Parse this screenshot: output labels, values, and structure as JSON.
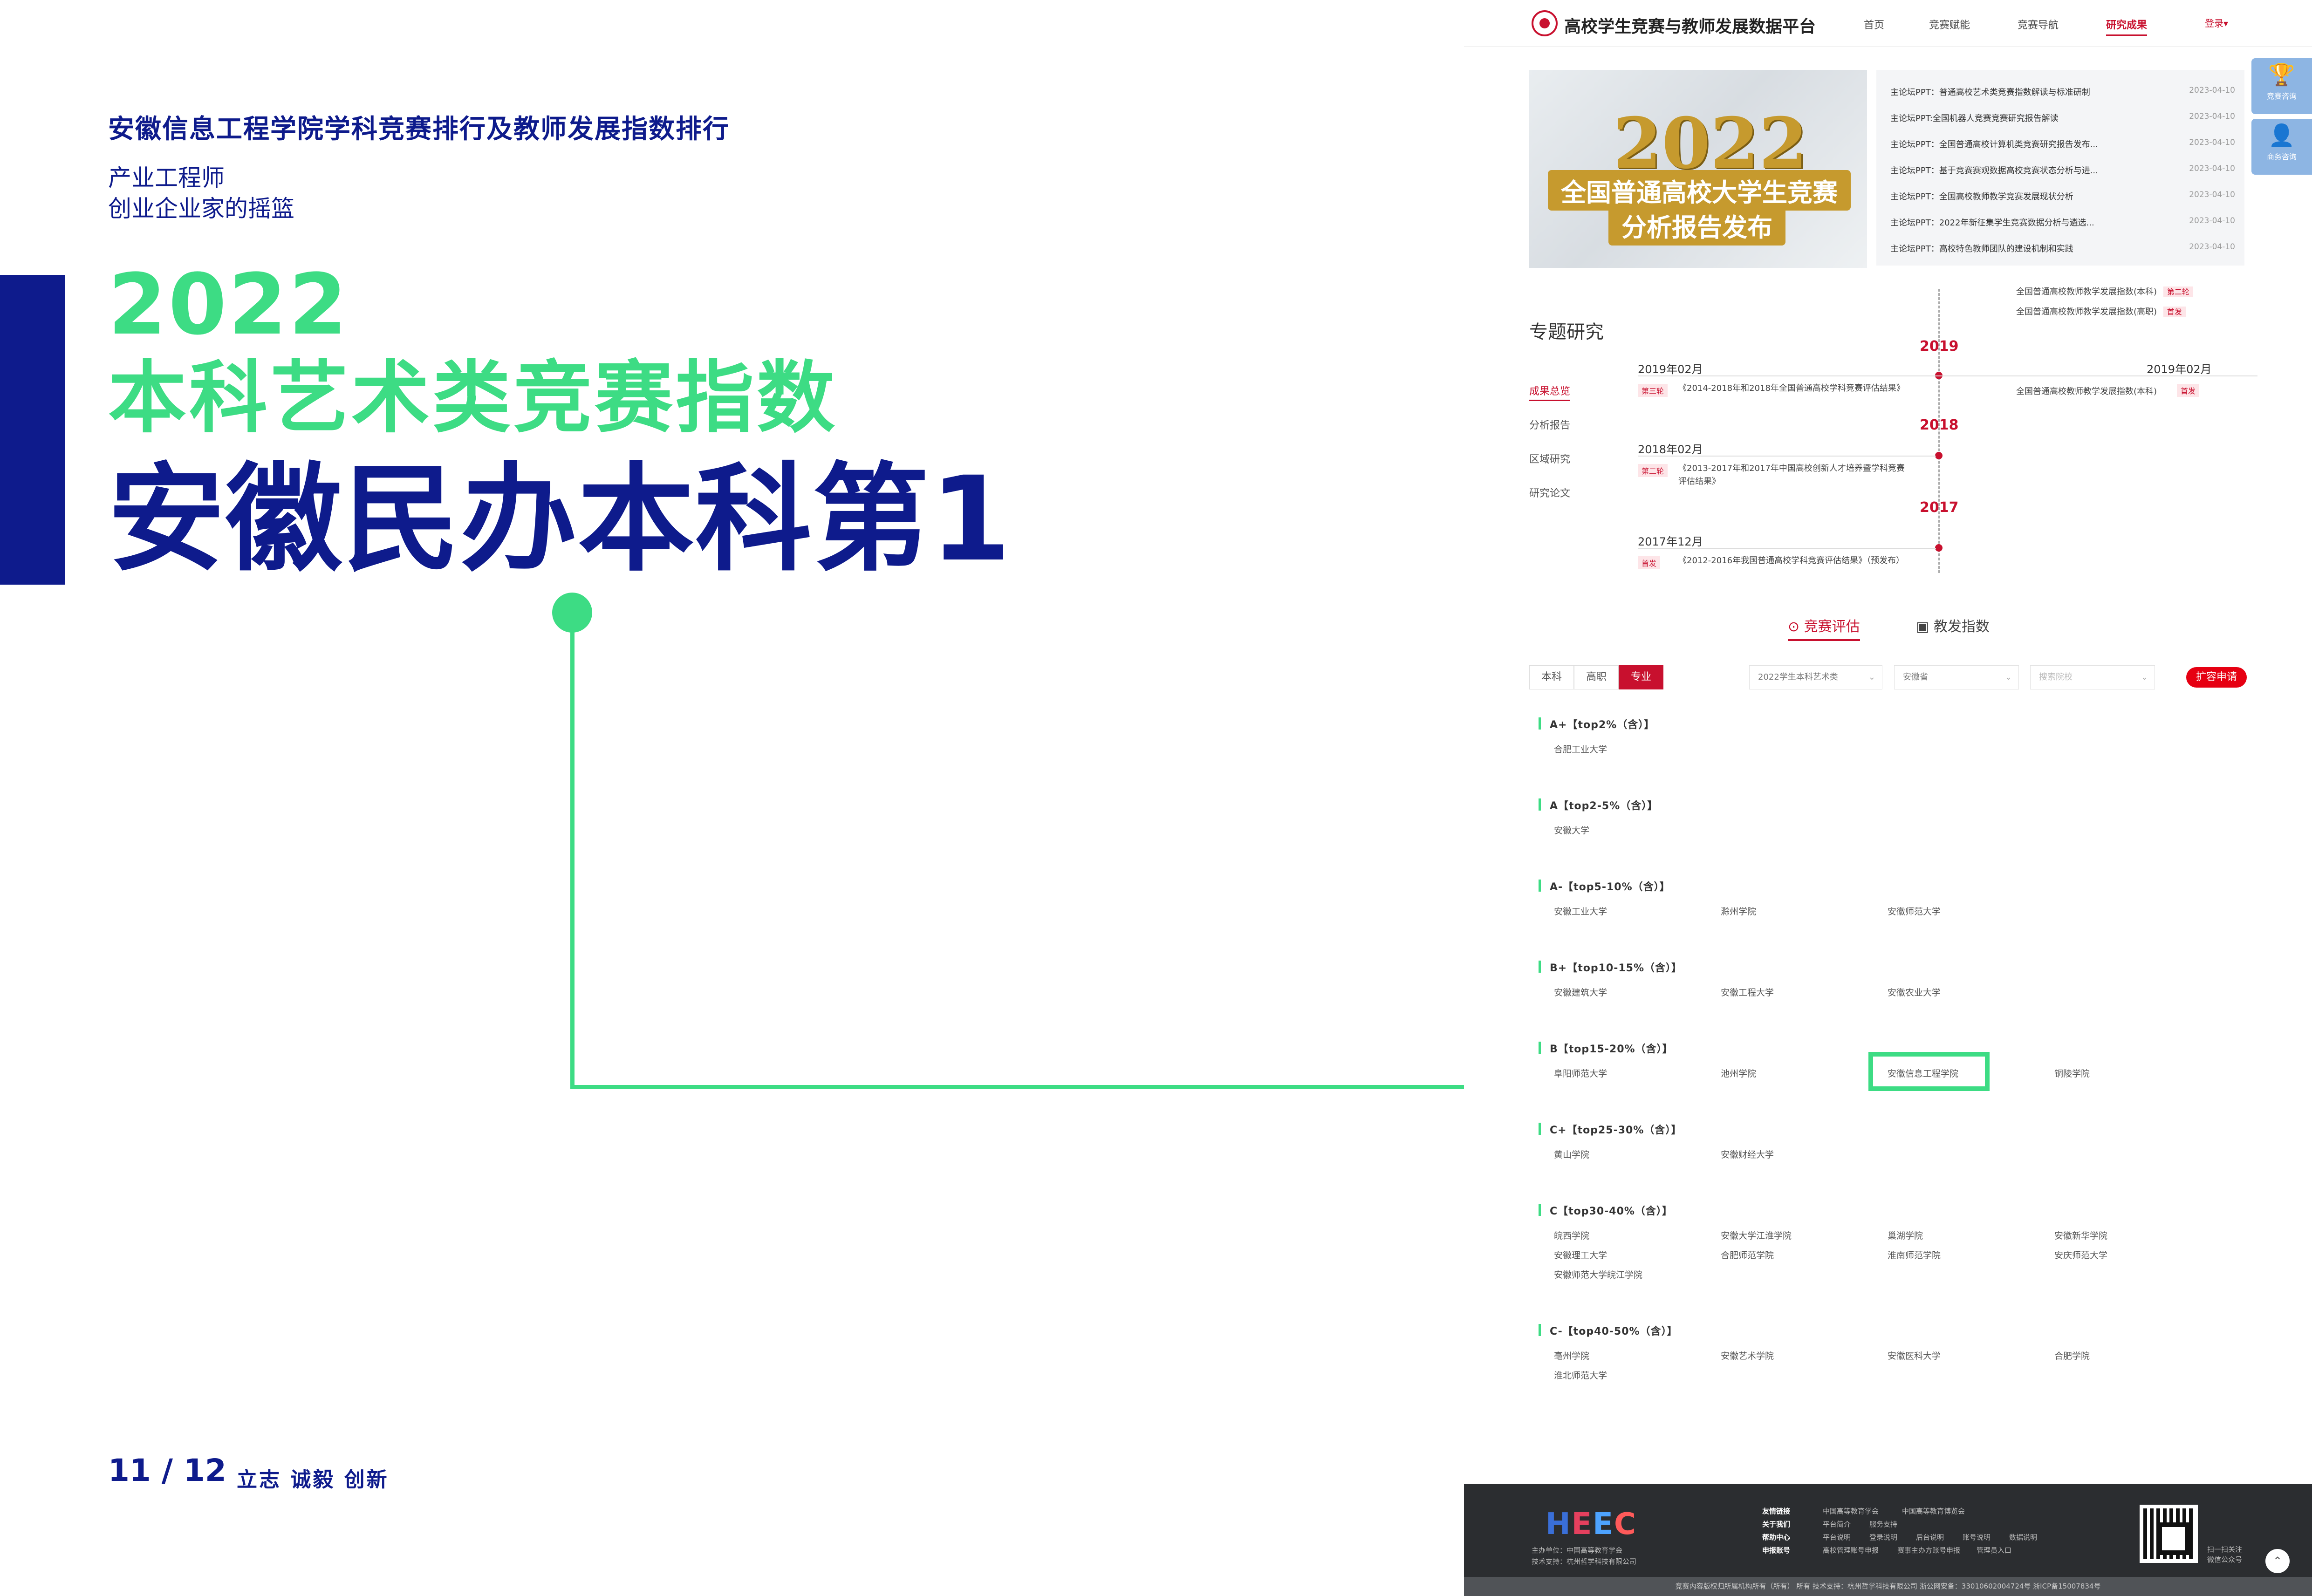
{
  "slide": {
    "header_title": "安徽信息工程学院学科竞赛排行及教师发展指数排行",
    "tagline_1": "产业工程师",
    "tagline_2": "创业企业家的摇篮",
    "big_year": "2022",
    "big_subtitle": "本科艺术类竞赛指数",
    "big_rank": "安徽民办本科第1",
    "page_number": "11 / 12",
    "motto": "立志  诚毅  创新",
    "accent_color": "#0e1b8c",
    "highlight_color": "#3ddc84"
  },
  "site": {
    "title": "高校学生竞赛与教师发展数据平台",
    "nav": [
      "首页",
      "竞赛赋能",
      "竞赛导航",
      "研究成果"
    ],
    "nav_active": "研究成果",
    "login": "登录▾",
    "float_buttons": [
      {
        "label": "竞赛咨询",
        "icon": "trophy-icon",
        "glyph": "🏆"
      },
      {
        "label": "商务咨询",
        "icon": "user-icon",
        "glyph": "👤"
      }
    ]
  },
  "banner": {
    "year": "2022",
    "line1": "全国普通高校大学生竞赛",
    "line2": "分析报告发布"
  },
  "news": [
    {
      "title": "主论坛PPT：普通高校艺术类竞赛指数解读与标准研制",
      "date": "2023-04-10"
    },
    {
      "title": "主论坛PPT:全国机器人竞赛竞赛研究报告解读",
      "date": "2023-04-10"
    },
    {
      "title": "主论坛PPT：全国普通高校计算机类竞赛研究报告发布...",
      "date": "2023-04-10"
    },
    {
      "title": "主论坛PPT：基于竞赛赛观数据高校竞赛状态分析与进...",
      "date": "2023-04-10"
    },
    {
      "title": "主论坛PPT：全国高校教师教学竞赛发展现状分析",
      "date": "2023-04-10"
    },
    {
      "title": "主论坛PPT：2022年新征集学生竞赛数据分析与遴选...",
      "date": "2023-04-10"
    },
    {
      "title": "主论坛PPT：高校特色教师团队的建设机制和实践",
      "date": "2023-04-10"
    }
  ],
  "topic": {
    "title": "专题研究",
    "menu": [
      "成果总览",
      "分析报告",
      "区域研究",
      "研究论文"
    ],
    "menu_active": "成果总览"
  },
  "timeline": {
    "top_right": [
      {
        "text": "全国普通高校教师教学发展指数(本科)",
        "badge": "第二轮"
      },
      {
        "text": "全国普通高校教师教学发展指数(高职)",
        "badge": "首发"
      }
    ],
    "entries": [
      {
        "year": "2019",
        "date_left": "2019年02月",
        "badge": "第三轮",
        "text": "《2014-2018年和2018年全国普通高校学科竞赛评估结果》",
        "date_right": "2019年02月",
        "right_text": "全国普通高校教师教学发展指数(本科)",
        "right_badge": "首发"
      },
      {
        "year": "2018",
        "date_left": "2018年02月",
        "badge": "第二轮",
        "text": "《2013-2017年和2017年中国高校创新人才培养暨学科竞赛评估结果》"
      },
      {
        "year": "2017",
        "date_left": "2017年12月",
        "badge": "首发",
        "text": "《2012-2016年我国普通高校学科竞赛评估结果》（预发布）"
      }
    ]
  },
  "tabs": [
    "竞赛评估",
    "教发指数"
  ],
  "tabs_active": "竞赛评估",
  "filters": {
    "segments": [
      "本科",
      "高职",
      "专业"
    ],
    "segment_active": "专业",
    "select_1": "2022学生本科艺术类",
    "select_2": "安徽省",
    "select_3": "搜索院校",
    "apply": "扩容申请"
  },
  "rankings": [
    {
      "head": "A+【top2%（含）】",
      "schools": [
        "合肥工业大学"
      ]
    },
    {
      "head": "A【top2-5%（含）】",
      "schools": [
        "安徽大学"
      ]
    },
    {
      "head": "A-【top5-10%（含）】",
      "schools": [
        "安徽工业大学",
        "滁州学院",
        "安徽师范大学"
      ]
    },
    {
      "head": "B+【top10-15%（含）】",
      "schools": [
        "安徽建筑大学",
        "安徽工程大学",
        "安徽农业大学"
      ]
    },
    {
      "head": "B【top15-20%（含）】",
      "schools": [
        "阜阳师范大学",
        "池州学院",
        "安徽信息工程学院",
        "铜陵学院"
      ]
    },
    {
      "head": "C+【top25-30%（含）】",
      "schools": [
        "黄山学院",
        "安徽财经大学"
      ]
    },
    {
      "head": "C【top30-40%（含）】",
      "schools": [
        "皖西学院",
        "安徽大学江淮学院",
        "巢湖学院",
        "安徽新华学院",
        "安徽理工大学",
        "合肥师范学院",
        "淮南师范学院",
        "安庆师范大学",
        "安徽师范大学皖江学院"
      ]
    },
    {
      "head": "C-【top40-50%（含）】",
      "schools": [
        "亳州学院",
        "安徽艺术学院",
        "安徽医科大学",
        "合肥学院",
        "淮北师范大学"
      ]
    }
  ],
  "highlighted_school": "安徽信息工程学院",
  "footer": {
    "logo": [
      "H",
      "E",
      "E",
      "C"
    ],
    "host": "主办单位：中国高等教育学会",
    "tech": "技术支持：杭州哲学科技有限公司",
    "links_label": "友情链接",
    "links": [
      "中国高等教育学会",
      "中国高等教育博览会"
    ],
    "about_label": "关于我们",
    "about": [
      "平台简介",
      "服务支持"
    ],
    "help_label": "帮助中心",
    "help": [
      "平台说明",
      "登录说明",
      "后台说明",
      "账号说明",
      "数据说明"
    ],
    "apply_label": "申报账号",
    "apply": [
      "高校管理账号申报",
      "赛事主办方账号申报",
      "管理员入口"
    ],
    "qr_label_1": "扫一扫关注",
    "qr_label_2": "微信公众号",
    "bottom": "竞赛内容版权归所属机构所有（所有） 所有  技术支持：杭州哲学科技有限公司  浙公网安备：33010602004724号   浙ICP备15007834号"
  }
}
